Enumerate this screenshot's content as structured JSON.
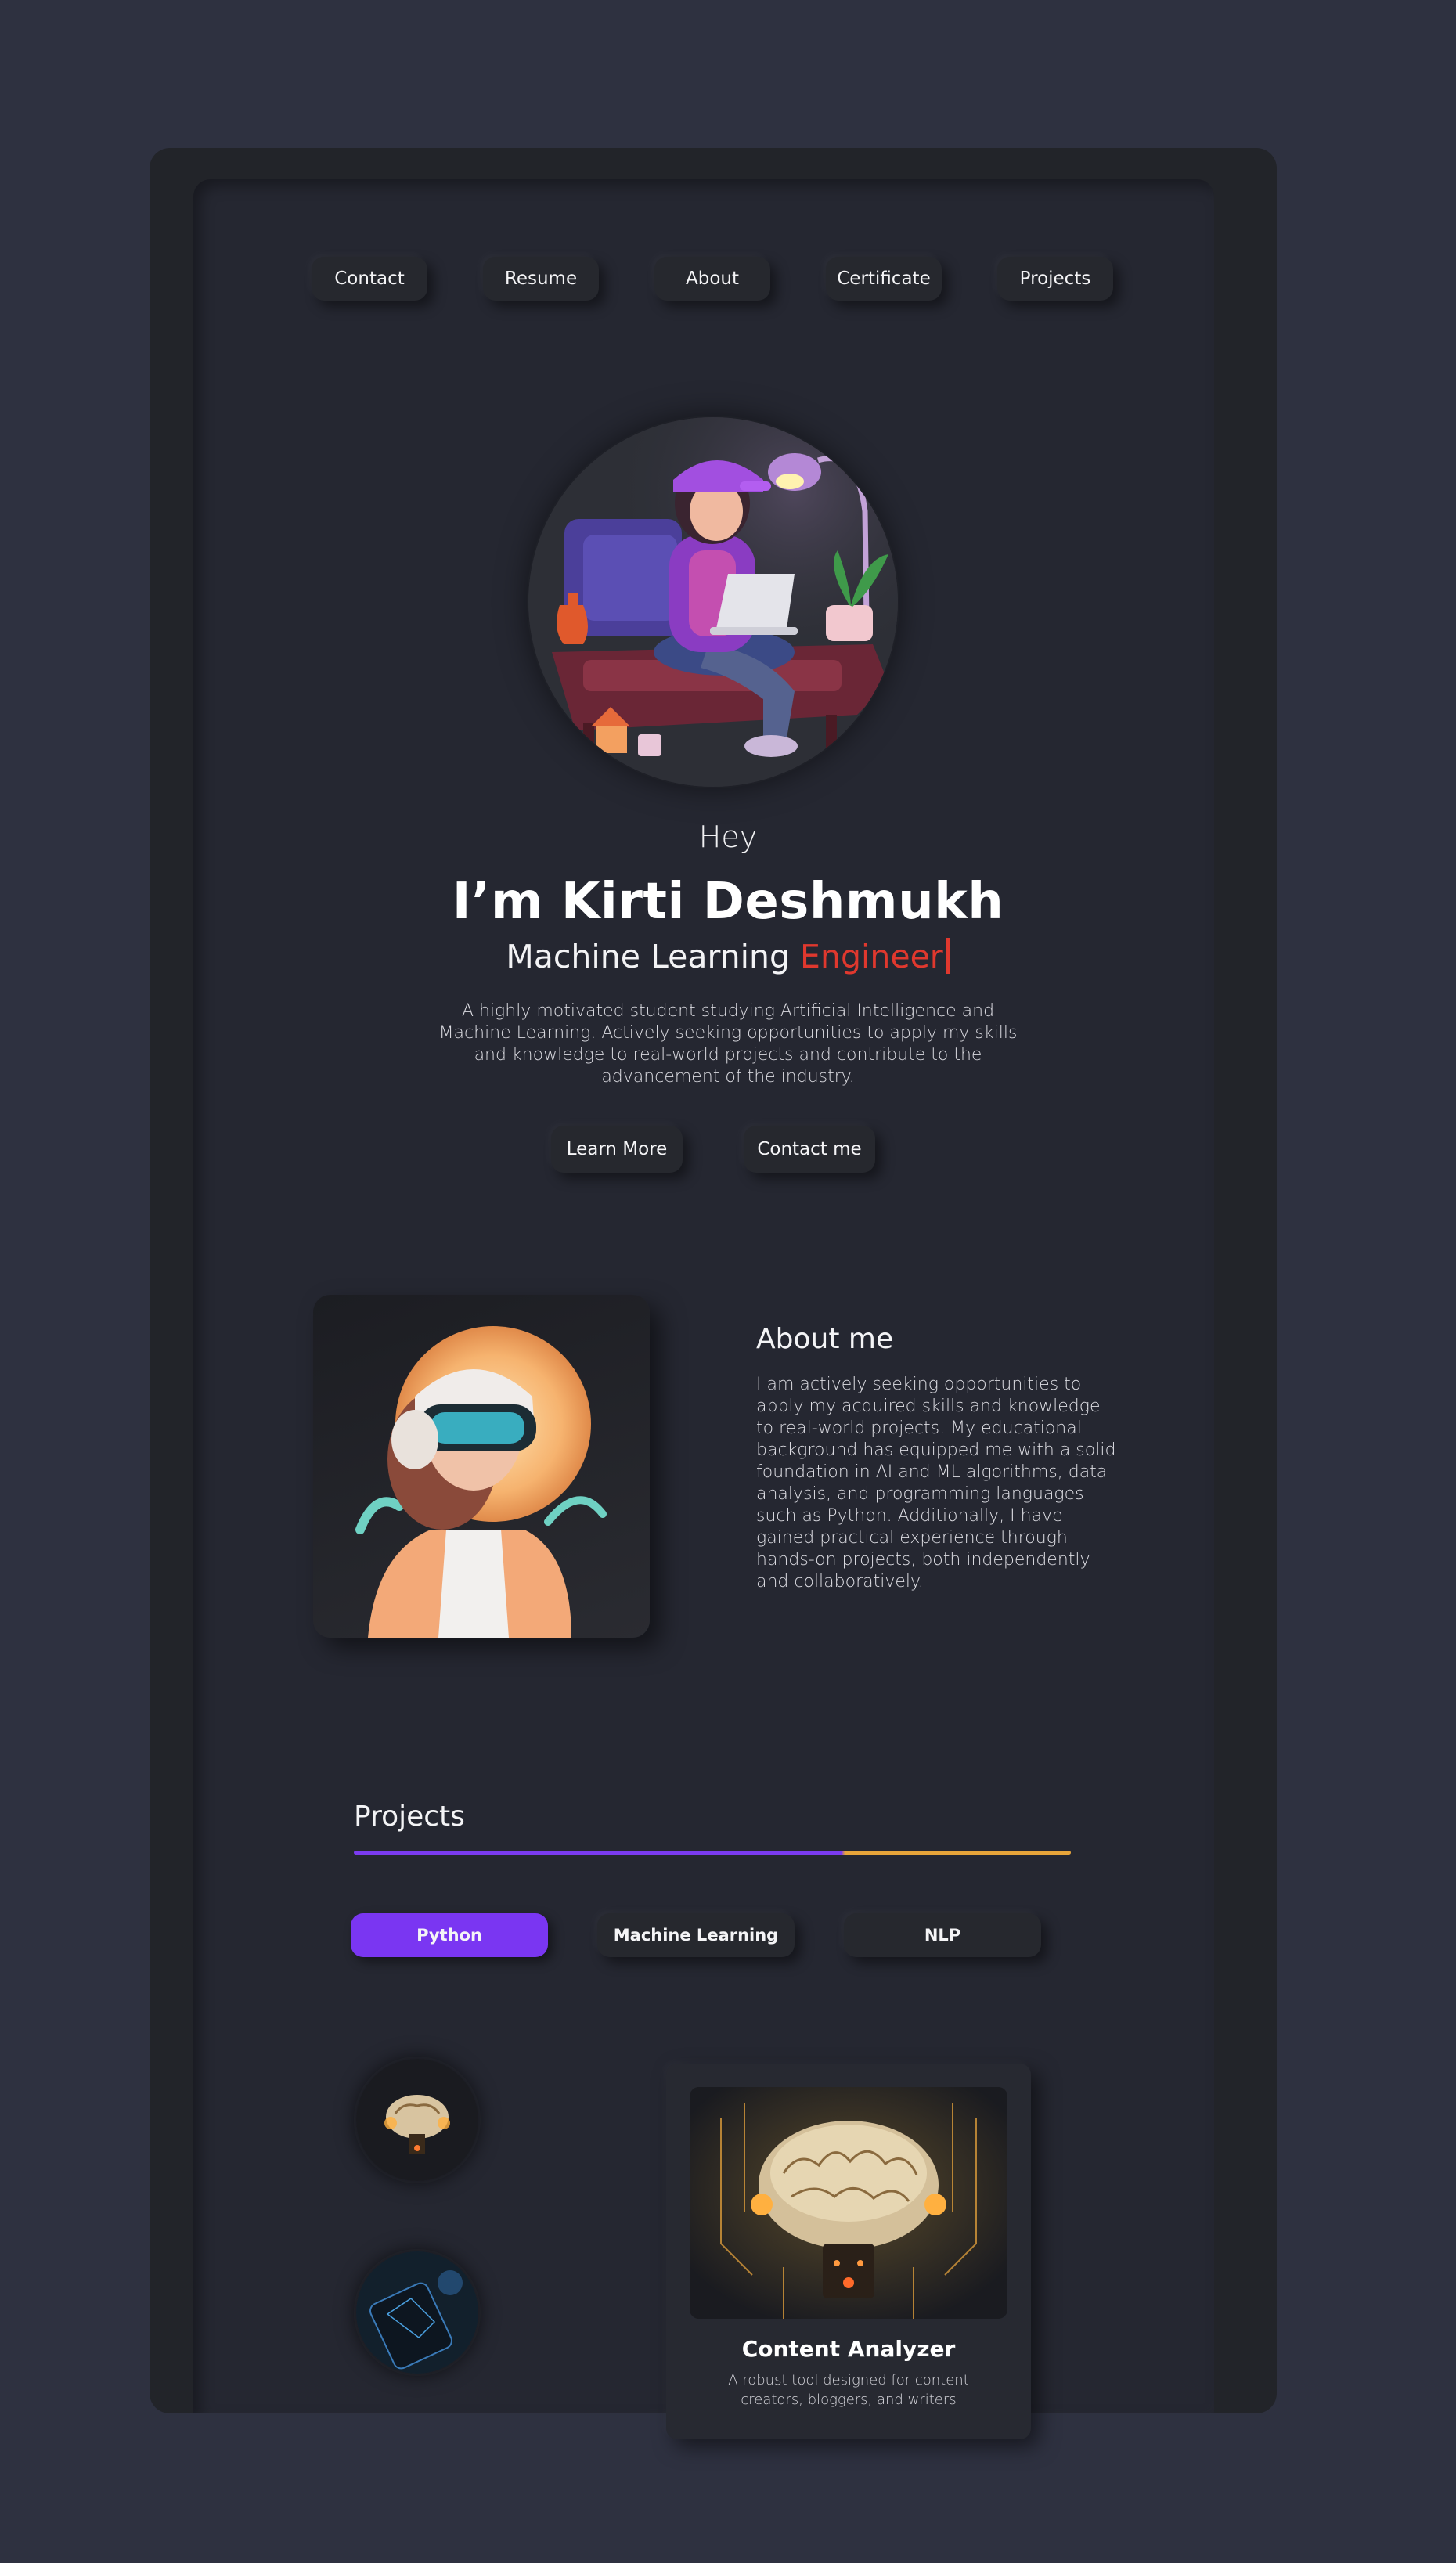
{
  "nav": {
    "items": [
      "Contact",
      "Resume",
      "About",
      "Certificate",
      "Projects"
    ]
  },
  "hero": {
    "greeting": "Hey",
    "name": "I’m Kirti Deshmukh",
    "role_prefix": "Machine Learning",
    "role_accent": "Engineer",
    "intro": "A highly motivated student studying Artificial Intelligence and Machine Learning. Actively seeking opportunities to apply my skills and knowledge to real-world projects and contribute to the advancement of the industry.",
    "buttons": {
      "learn_more": "Learn More",
      "contact": "Contact me"
    }
  },
  "about": {
    "title": "About me",
    "text": "I am actively seeking opportunities to apply my acquired skills and knowledge to real-world projects. My educational background has equipped me with a solid foundation in AI and ML algorithms, data analysis, and programming languages such as Python. Additionally, I have gained practical experience through hands-on projects, both independently and collaboratively."
  },
  "projects": {
    "title": "Projects",
    "filters": [
      "Python",
      "Machine Learning",
      "NLP"
    ],
    "active_filter": "Python",
    "card": {
      "title": "Content Analyzer",
      "description": "A robust tool designed for content creators, bloggers, and writers"
    }
  },
  "colors": {
    "background": "#2e3140",
    "accent_red": "#e0382e",
    "accent_purple": "#7a36f2",
    "accent_orange": "#e8a53a"
  }
}
